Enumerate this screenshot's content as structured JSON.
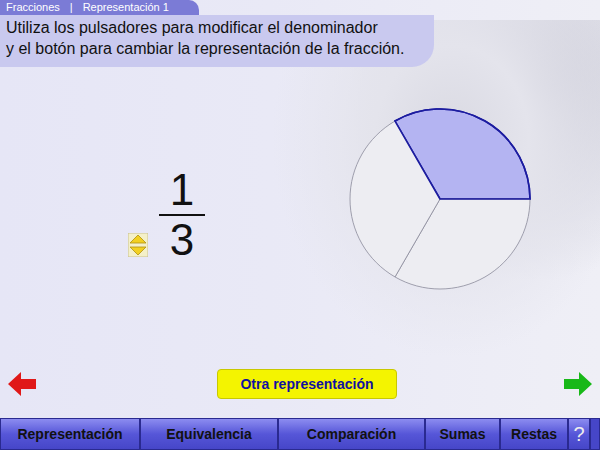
{
  "breadcrumb": {
    "items": [
      "Fracciones",
      "Representación 1"
    ],
    "separator": "|"
  },
  "instructions": [
    "Utiliza los pulsadores para modificar el denominador",
    "y el botón para cambiar la representación de la fracción."
  ],
  "fraction": {
    "numerator": "1",
    "denominator": "3"
  },
  "pie": {
    "slices": 3,
    "filled": 1
  },
  "action_button": "Otra representación",
  "nav": [
    {
      "label": "Representación"
    },
    {
      "label": "Equivalencia"
    },
    {
      "label": "Comparación"
    },
    {
      "label": "Sumas"
    },
    {
      "label": "Restas"
    },
    {
      "label": "?"
    }
  ]
}
